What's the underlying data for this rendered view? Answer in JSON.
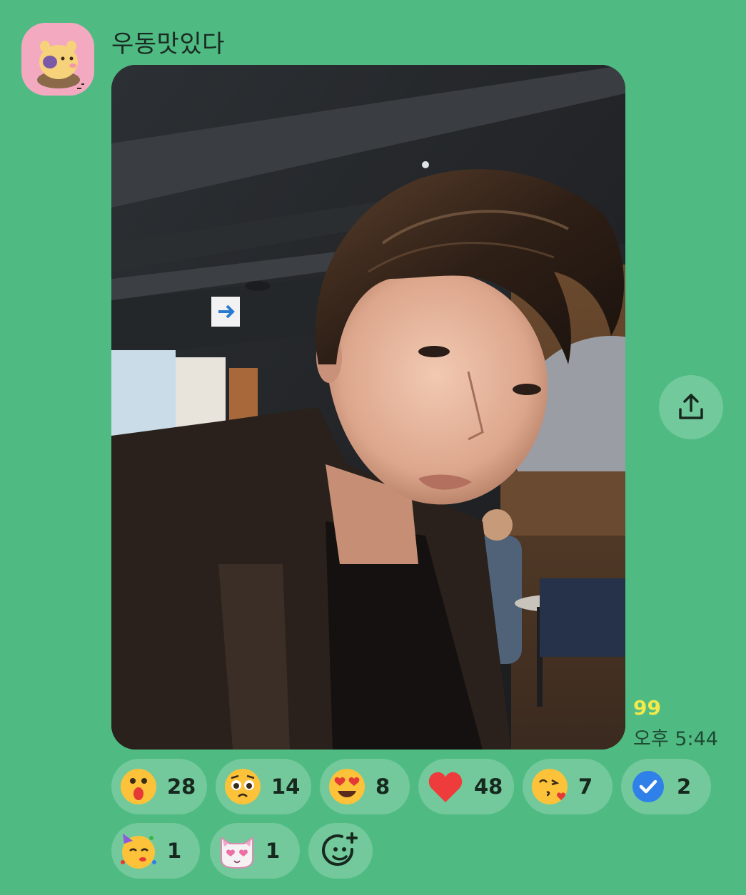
{
  "message": {
    "sender_name": "우동맛있다",
    "unread_count": "99",
    "time": "오후 5:44"
  },
  "icons": {
    "avatar": "avatar-character-icon",
    "share": "share-upload-icon",
    "add_reaction": "add-reaction-icon"
  },
  "colors": {
    "background": "#4fbb83",
    "pill": "#73c99b",
    "unread": "#f2e94a"
  },
  "reactions": [
    {
      "emoji": "surprised-face",
      "count": "28"
    },
    {
      "emoji": "pleading-face",
      "count": "14"
    },
    {
      "emoji": "heart-eyes-face",
      "count": "8"
    },
    {
      "emoji": "red-heart",
      "count": "48"
    },
    {
      "emoji": "kissing-heart-face",
      "count": "7"
    },
    {
      "emoji": "blue-check",
      "count": "2"
    },
    {
      "emoji": "party-face",
      "count": "1"
    },
    {
      "emoji": "pink-cat-heart-eyes",
      "count": "1"
    }
  ]
}
